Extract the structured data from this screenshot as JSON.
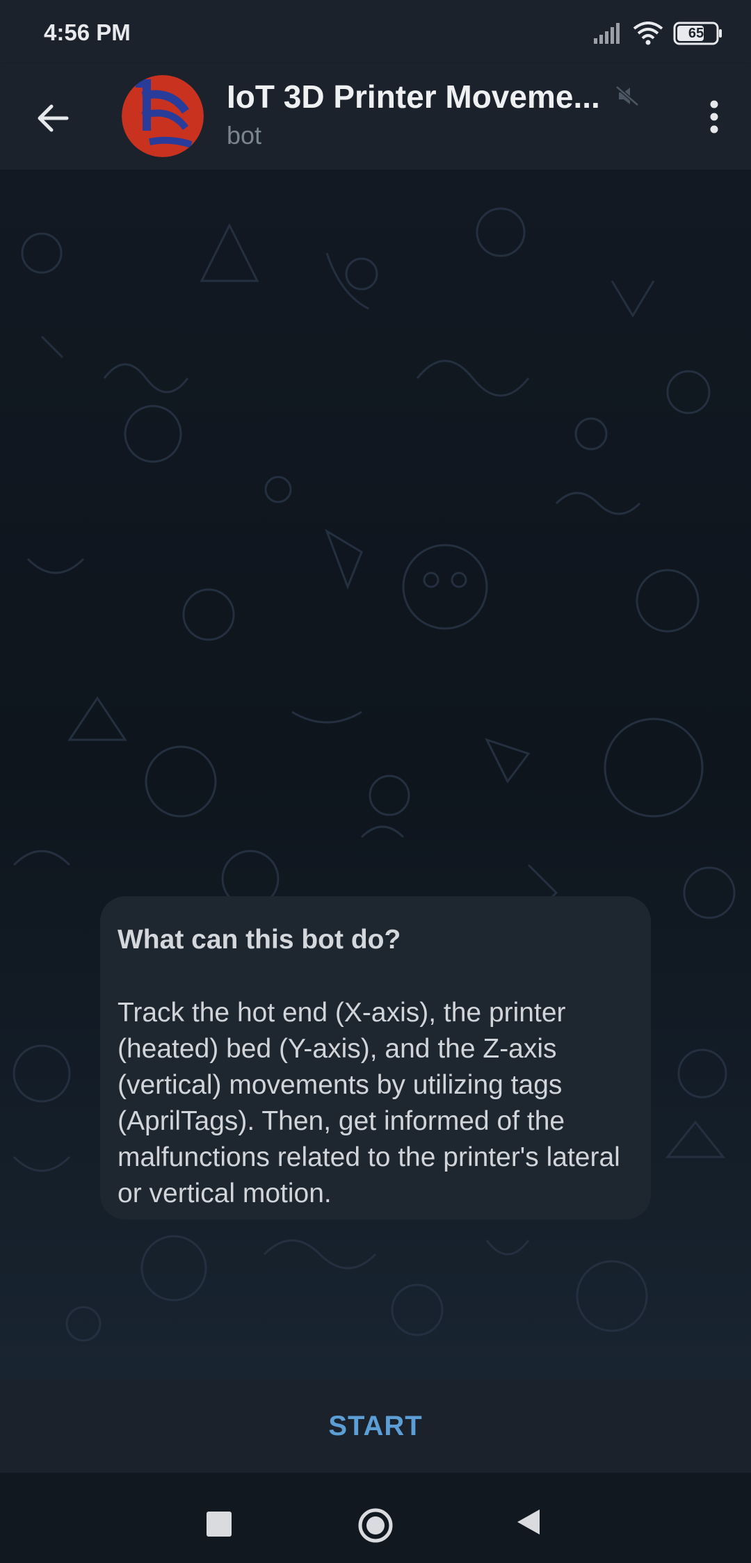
{
  "status_bar": {
    "time": "4:56 PM",
    "battery": "65",
    "icons": [
      "signal-icon",
      "wifi-icon",
      "battery-icon"
    ]
  },
  "header": {
    "title": "IoT 3D Printer Moveme...",
    "subtitle": "bot",
    "icons": [
      "back-arrow-icon",
      "bot-avatar",
      "mute-icon",
      "more-vert-icon"
    ]
  },
  "bubble": {
    "title": "What can this bot do?",
    "text": "Track the hot end (X-axis), the printer (heated) bed (Y-axis), and the Z-axis (vertical) movements by utilizing tags (AprilTags). Then, get informed of the malfunctions related to the printer's lateral or vertical motion."
  },
  "bottom_bar": {
    "start_label": "START"
  },
  "nav_bar": {
    "icons": [
      "recents-icon",
      "home-icon",
      "back-icon"
    ]
  },
  "colors": {
    "header_bg": "#1b222c",
    "accent": "#5c9fd6",
    "bubble_bg": "#1e2630",
    "avatar_red": "#c8321e",
    "avatar_blue": "#2a3c9a"
  }
}
